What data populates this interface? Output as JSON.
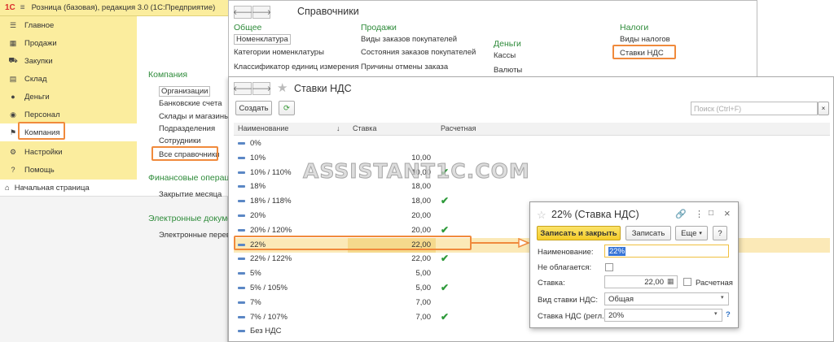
{
  "app": {
    "logo": "1С",
    "title": "Розница (базовая), редакция 3.0  (1С:Предприятие)"
  },
  "sidebar": {
    "items": [
      {
        "label": "Главное",
        "icon": "☰"
      },
      {
        "label": "Продажи",
        "icon": "▦"
      },
      {
        "label": "Закупки",
        "icon": "⛟"
      },
      {
        "label": "Склад",
        "icon": "▤"
      },
      {
        "label": "Деньги",
        "icon": "●"
      },
      {
        "label": "Персонал",
        "icon": "◉"
      },
      {
        "label": "Компания",
        "icon": "⚑"
      },
      {
        "label": "Настройки",
        "icon": "⚙"
      },
      {
        "label": "Помощь",
        "icon": "?"
      }
    ],
    "home": "Начальная страница"
  },
  "company_panel": {
    "heading": "Компания",
    "links": [
      "Организации",
      "Банковские счета",
      "Склады и магазины",
      "Подразделения",
      "Сотрудники",
      "Все справочники"
    ],
    "finance_heading": "Финансовые операци",
    "finance_links": [
      "Закрытие месяца"
    ],
    "edoc_heading": "Электронные докуме",
    "edoc_links": [
      "Электронные перево"
    ]
  },
  "directories": {
    "title": "Справочники",
    "general": {
      "heading": "Общее",
      "links": [
        "Номенклатура",
        "Категории номенклатуры",
        "Классификатор единиц измерения"
      ]
    },
    "sales": {
      "heading": "Продажи",
      "links": [
        "Виды заказов покупателей",
        "Состояния заказов покупателей",
        "Причины отмены заказа"
      ]
    },
    "money": {
      "heading": "Деньги",
      "links": [
        "Кассы",
        "Валюты"
      ]
    },
    "taxes": {
      "heading": "Налоги",
      "links": [
        "Виды налогов",
        "Ставки НДС"
      ]
    }
  },
  "vat_list": {
    "title": "Ставки НДС",
    "create_button": "Создать",
    "search_placeholder": "Поиск (Ctrl+F)",
    "columns": {
      "name": "Наименование",
      "sort": "↓",
      "rate": "Ставка",
      "calc": "Расчетная"
    },
    "rows": [
      {
        "name": "0%",
        "rate": "",
        "calc": ""
      },
      {
        "name": "10%",
        "rate": "10,00",
        "calc": ""
      },
      {
        "name": "10% / 110%",
        "rate": "10,00",
        "calc": "✔"
      },
      {
        "name": "18%",
        "rate": "18,00",
        "calc": ""
      },
      {
        "name": "18% / 118%",
        "rate": "18,00",
        "calc": "✔"
      },
      {
        "name": "20%",
        "rate": "20,00",
        "calc": ""
      },
      {
        "name": "20% / 120%",
        "rate": "20,00",
        "calc": "✔"
      },
      {
        "name": "22%",
        "rate": "22,00",
        "calc": ""
      },
      {
        "name": "22% / 122%",
        "rate": "22,00",
        "calc": "✔"
      },
      {
        "name": "5%",
        "rate": "5,00",
        "calc": ""
      },
      {
        "name": "5% / 105%",
        "rate": "5,00",
        "calc": "✔"
      },
      {
        "name": "7%",
        "rate": "7,00",
        "calc": ""
      },
      {
        "name": "7% / 107%",
        "rate": "7,00",
        "calc": "✔"
      },
      {
        "name": "Без НДС",
        "rate": "",
        "calc": ""
      }
    ]
  },
  "dialog": {
    "title": "22% (Ставка НДС)",
    "save_close": "Записать и закрыть",
    "save": "Записать",
    "more": "Еще",
    "help": "?",
    "name_label": "Наименование:",
    "name_value": "22%",
    "not_taxed_label": "Не облагается:",
    "rate_label": "Ставка:",
    "rate_value": "22,00",
    "calc_label": "Расчетная",
    "kind_label": "Вид ставки НДС:",
    "kind_value": "Общая",
    "reg_label": "Ставка НДС (регл.):",
    "reg_value": "20%",
    "reg_help": "?"
  },
  "watermark": "ASSISTANT1C.COM",
  "colors": {
    "accent_orange": "#f08a3c",
    "sidebar_yellow": "#fbed9e",
    "section_green": "#2e8b3a",
    "check_green": "#2e9a3a",
    "primary_button": "#f5d23a"
  }
}
